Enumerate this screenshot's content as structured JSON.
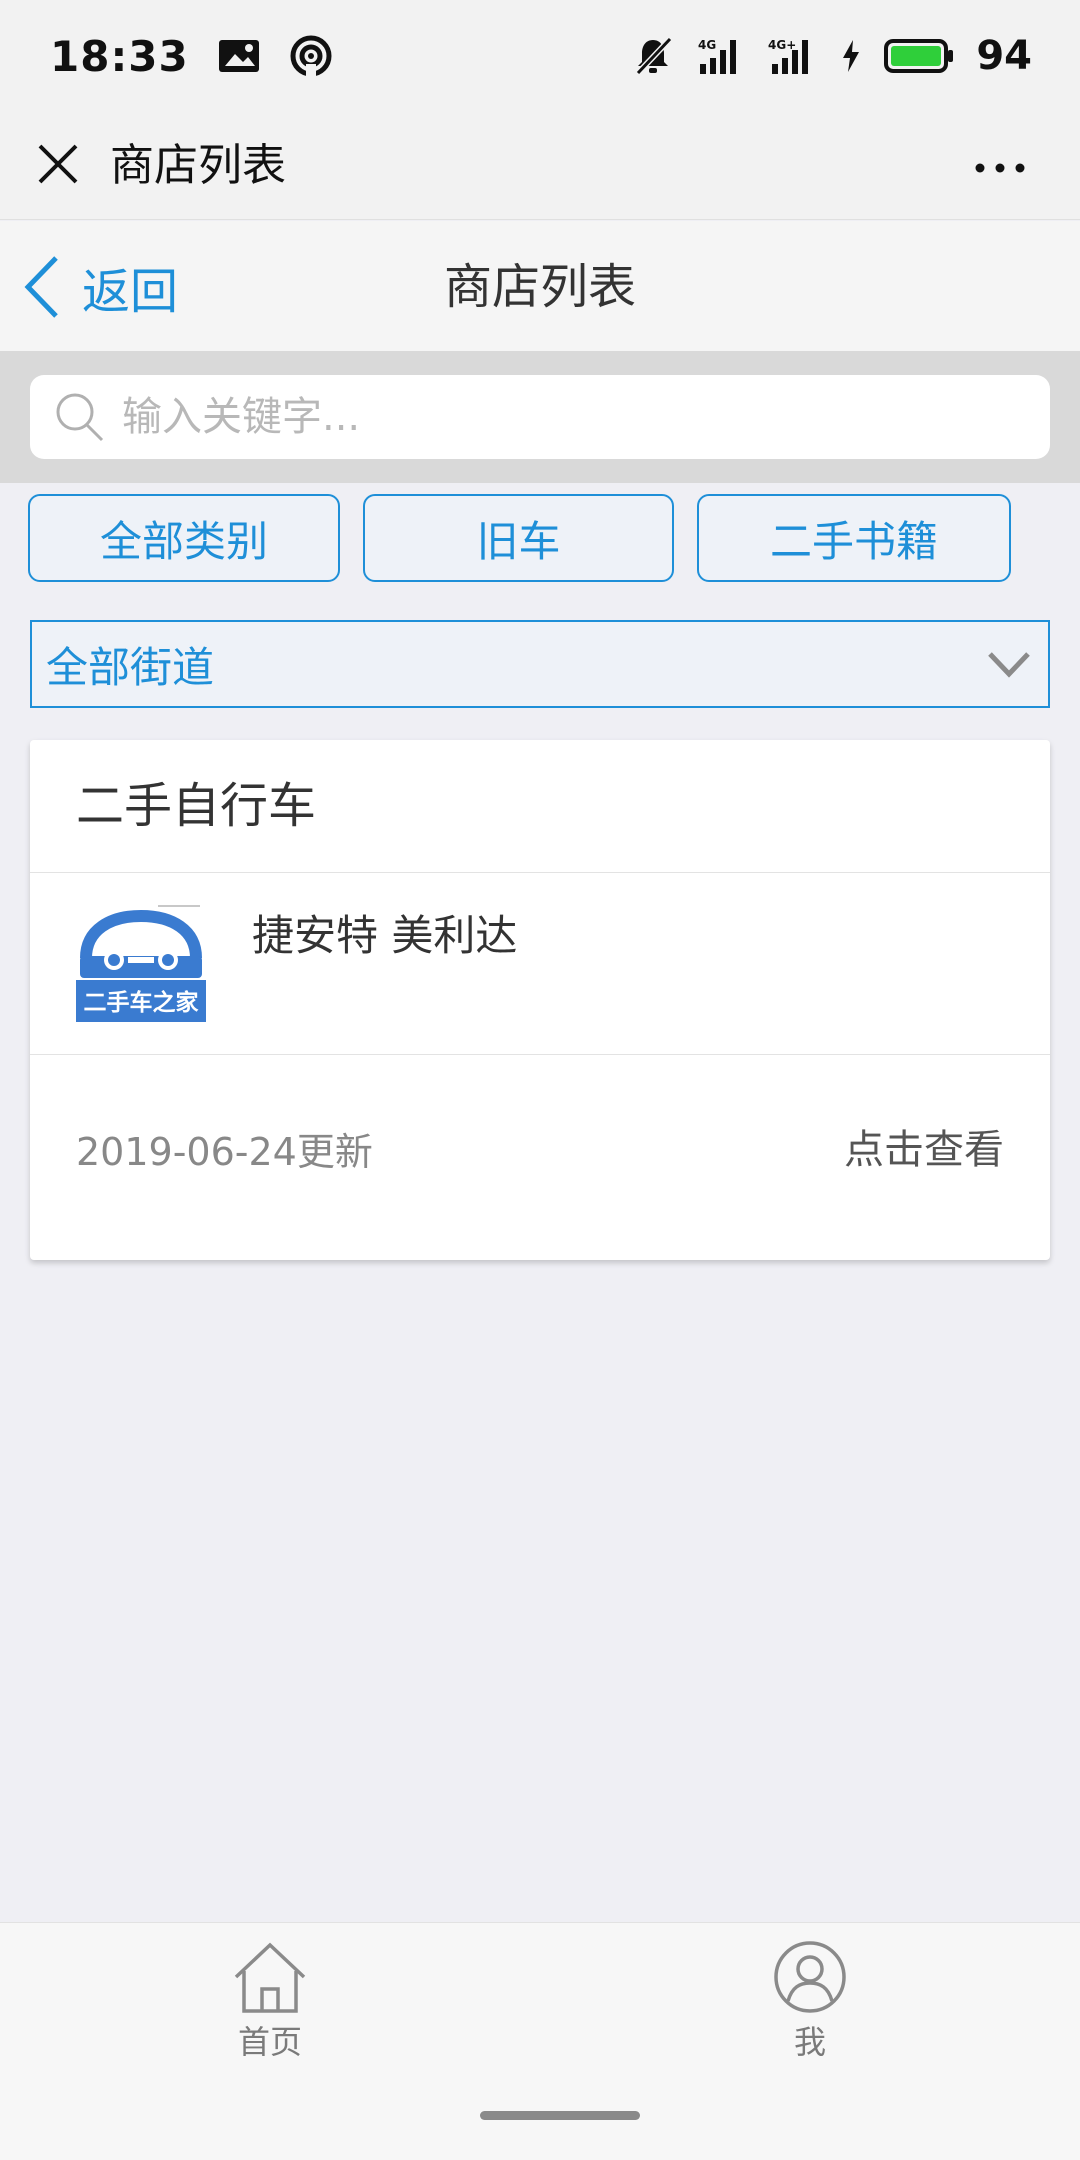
{
  "status": {
    "time": "18:33",
    "battery_pct": "94",
    "signal1_label": "4G",
    "signal2_label": "4G+"
  },
  "wechat": {
    "title": "商店列表"
  },
  "header": {
    "back_label": "返回",
    "title": "商店列表"
  },
  "search": {
    "placeholder": "输入关键字...",
    "value": ""
  },
  "categories": [
    "全部类别",
    "旧车",
    "二手书籍"
  ],
  "street_filter": {
    "selected": "全部街道"
  },
  "card": {
    "title": "二手自行车",
    "item_name": "捷安特 美利达",
    "logo_text": "二手车之家",
    "updated": "2019-06-24更新",
    "view_label": "点击查看"
  },
  "tabs": [
    {
      "label": "首页",
      "icon": "home-icon"
    },
    {
      "label": "我",
      "icon": "user-icon"
    }
  ],
  "colors": {
    "accent": "#1e8fd8",
    "background": "#efeff4",
    "logo_blue": "#3a7bd0"
  }
}
